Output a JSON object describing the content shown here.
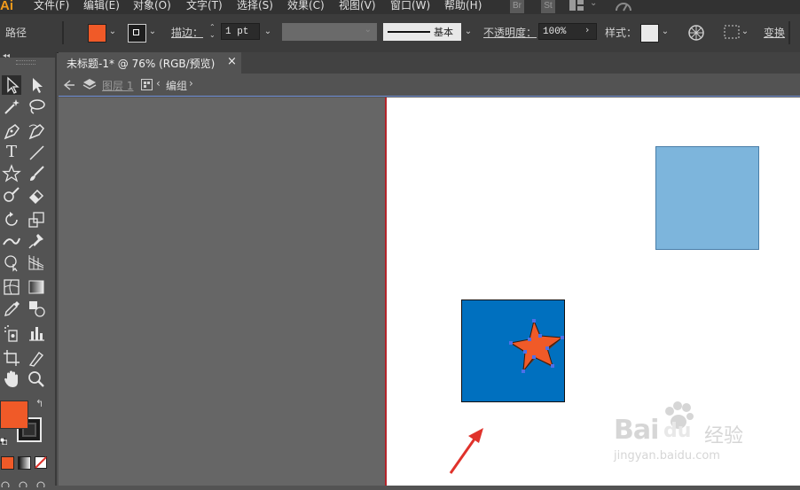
{
  "app": {
    "logo": "Ai",
    "menu": [
      "文件(F)",
      "编辑(E)",
      "对象(O)",
      "文字(T)",
      "选择(S)",
      "效果(C)",
      "视图(V)",
      "窗口(W)",
      "帮助(H)"
    ],
    "bridge_label": "Br",
    "stock_label": "St"
  },
  "control_bar": {
    "selection_type": "路径",
    "fill_color": "#f05a28",
    "stroke_label": "描边：",
    "stroke_weight": "1 pt",
    "brush_label": "基本",
    "opacity_label": "不透明度：",
    "opacity_value": "100%",
    "style_label": "样式：",
    "transform_label": "变换"
  },
  "document": {
    "tab_title": "未标题-1* @ 76% (RGB/预览)",
    "close_symbol": "×",
    "breadcrumb_layer": "图层 1",
    "breadcrumb_group": "编组"
  },
  "tools_panel": {
    "fill_color": "#f05a28",
    "stroke_color": "#000000"
  },
  "canvas": {
    "objects": [
      {
        "name": "light-blue-square",
        "color": "#7db5dc"
      },
      {
        "name": "dark-blue-square",
        "color": "#0070bf"
      },
      {
        "name": "orange-star",
        "color": "#f05a28",
        "shadow": "#6b3318"
      }
    ],
    "annotation_arrow_color": "#e0322b"
  },
  "watermark": {
    "brand": "Bai",
    "brand2": "du",
    "chinese": "经验",
    "url": "jingyan.baidu.com"
  }
}
